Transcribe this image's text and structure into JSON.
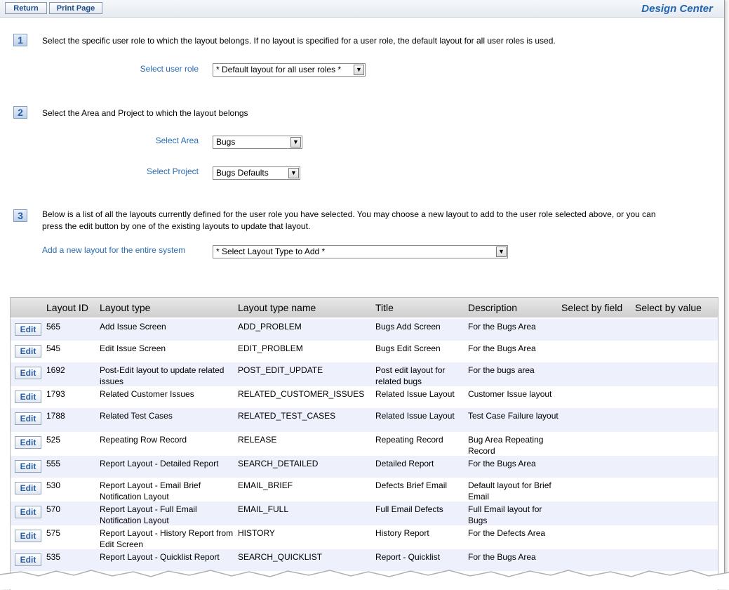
{
  "toolbar": {
    "return_label": "Return",
    "print_label": "Print Page",
    "brand": "Design Center"
  },
  "step1": {
    "num": "1",
    "text": "Select the specific user role to which the layout belongs. If no layout is specified for a user role, the default layout for all user roles is used.",
    "role_label": "Select user role",
    "role_value": "* Default layout for all user roles *"
  },
  "step2": {
    "num": "2",
    "text": "Select the Area and Project to which the layout belongs",
    "area_label": "Select Area",
    "area_value": "Bugs",
    "project_label": "Select Project",
    "project_value": "Bugs Defaults"
  },
  "step3": {
    "num": "3",
    "text_line1": "Below is a list of all the layouts currently defined for the user role you have selected. You may choose a new layout to add to the user role selected above, or you can",
    "text_line2": "press the edit button by one of the existing layouts to update that layout.",
    "add_label": "Add a new layout for the entire system",
    "add_value": "* Select Layout Type to Add *"
  },
  "table": {
    "headers": [
      "Layout ID",
      "Layout type",
      "Layout type name",
      "Title",
      "Description",
      "Select by field",
      "Select by value"
    ],
    "edit_label": "Edit",
    "rows": [
      {
        "id": "565",
        "type": "Add Issue Screen",
        "type_name": "ADD_PROBLEM",
        "title": "Bugs Add Screen",
        "desc": "For the Bugs Area"
      },
      {
        "id": "545",
        "type": "Edit Issue Screen",
        "type_name": "EDIT_PROBLEM",
        "title": "Bugs Edit Screen",
        "desc": "For the Bugs Area"
      },
      {
        "id": "1692",
        "type": "Post-Edit layout to update related issues",
        "type_name": "POST_EDIT_UPDATE",
        "title": "Post edit layout for related bugs",
        "desc": "For the bugs area"
      },
      {
        "id": "1793",
        "type": "Related Customer Issues",
        "type_name": "RELATED_CUSTOMER_ISSUES",
        "title": "Related Issue Layout",
        "desc": "Customer Issue layout"
      },
      {
        "id": "1788",
        "type": "Related Test Cases",
        "type_name": "RELATED_TEST_CASES",
        "title": "Related Issue Layout",
        "desc": "Test Case Failure layout"
      },
      {
        "id": "525",
        "type": "Repeating Row Record",
        "type_name": "RELEASE",
        "title": "Repeating Record",
        "desc": "Bug Area Repeating Record"
      },
      {
        "id": "555",
        "type": "Report Layout - Detailed Report",
        "type_name": "SEARCH_DETAILED",
        "title": "Detailed Report",
        "desc": "For the Bugs Area"
      },
      {
        "id": "530",
        "type": "Report Layout - Email Brief Notification Layout",
        "type_name": "EMAIL_BRIEF",
        "title": "Defects Brief Email",
        "desc": "Default layout for Brief Email"
      },
      {
        "id": "570",
        "type": "Report Layout - Full Email Notification Layout",
        "type_name": "EMAIL_FULL",
        "title": "Full Email Defects",
        "desc": "Full Email layout for Bugs"
      },
      {
        "id": "575",
        "type": "Report Layout - History Report from Edit Screen",
        "type_name": "HISTORY",
        "title": "History Report",
        "desc": "For the Defects Area"
      },
      {
        "id": "535",
        "type": "Report Layout - Quicklist Report",
        "type_name": "SEARCH_QUICKLIST",
        "title": "Report - Quicklist",
        "desc": "For the Bugs Area"
      }
    ]
  }
}
